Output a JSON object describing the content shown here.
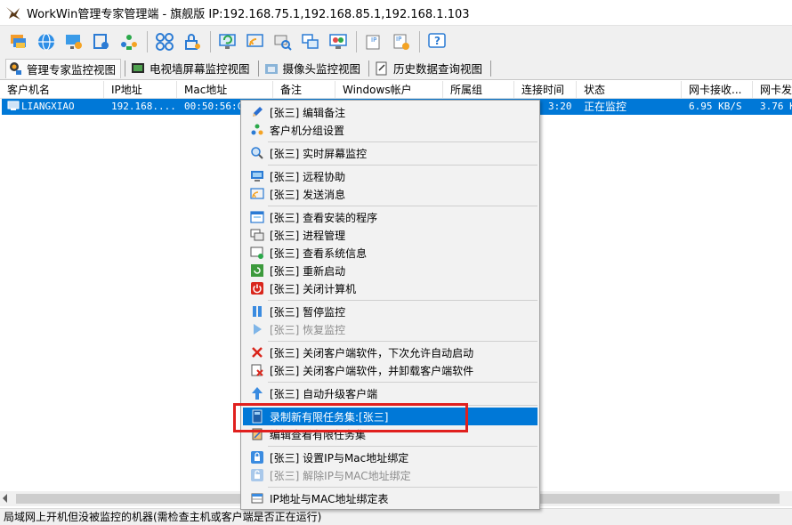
{
  "window": {
    "title": "WorkWin管理专家管理端 - 旗舰版 IP:192.168.75.1,192.168.85.1,192.168.1.103"
  },
  "toolbar": {
    "buttons": [
      {
        "icon": "layers-icon"
      },
      {
        "icon": "globe-icon"
      },
      {
        "icon": "monitor-network-icon"
      },
      {
        "icon": "remote-icon"
      },
      {
        "icon": "users-icon"
      },
      {
        "icon": "grid-icon"
      },
      {
        "icon": "lock-icon"
      },
      {
        "icon": "monitor-refresh-icon"
      },
      {
        "icon": "message-icon"
      },
      {
        "icon": "search-monitor-icon"
      },
      {
        "icon": "windows-icon"
      },
      {
        "icon": "monitor-chart-icon"
      },
      {
        "icon": "ip-tag-icon"
      },
      {
        "icon": "ip-lock-icon"
      },
      {
        "icon": "help-icon"
      }
    ]
  },
  "view_tabs": [
    {
      "label": "管理专家监控视图",
      "icon": "user-monitor-icon",
      "active": true
    },
    {
      "label": "电视墙屏幕监控视图",
      "icon": "tv-wall-icon",
      "active": false
    },
    {
      "label": "摄像头监控视图",
      "icon": "camera-icon",
      "active": false
    },
    {
      "label": "历史数据查询视图",
      "icon": "history-icon",
      "active": false
    }
  ],
  "table": {
    "columns": [
      "客户机名",
      "IP地址",
      "Mac地址",
      "备注",
      "Windows帐户",
      "所属组",
      "连接时间",
      "状态",
      "网卡接收...",
      "网卡发"
    ],
    "rows": [
      {
        "cells": [
          "LIANGXIAO",
          "192.168....",
          "00:50:56:C0",
          "",
          "",
          "",
          "3:20",
          "正在监控",
          "6.95 KB/S",
          "3.76 K"
        ],
        "selected": true
      }
    ]
  },
  "context_menu": {
    "items": [
      {
        "label": "[张三] 编辑备注",
        "icon": "pencil-icon",
        "disabled": false
      },
      {
        "label": "客户机分组设置",
        "icon": "group-icon",
        "disabled": false
      },
      {
        "label": "[张三] 实时屏幕监控",
        "icon": "magnifier-icon",
        "disabled": false
      },
      {
        "label": "[张三] 远程协助",
        "icon": "remote-assist-icon",
        "disabled": false
      },
      {
        "label": "[张三] 发送消息",
        "icon": "send-message-icon",
        "disabled": false
      },
      {
        "label": "[张三] 查看安装的程序",
        "icon": "programs-icon",
        "disabled": false
      },
      {
        "label": "[张三] 进程管理",
        "icon": "process-icon",
        "disabled": false
      },
      {
        "label": "[张三] 查看系统信息",
        "icon": "system-info-icon",
        "disabled": false
      },
      {
        "label": "[张三] 重新启动",
        "icon": "restart-icon",
        "disabled": false
      },
      {
        "label": "[张三] 关闭计算机",
        "icon": "power-icon",
        "disabled": false
      },
      {
        "label": "[张三] 暂停监控",
        "icon": "pause-icon",
        "disabled": false
      },
      {
        "label": "[张三] 恢复监控",
        "icon": "play-icon",
        "disabled": true
      },
      {
        "label": "[张三] 关闭客户端软件，下次允许自动启动",
        "icon": "close-x-icon",
        "disabled": false
      },
      {
        "label": "[张三] 关闭客户端软件，并卸载客户端软件",
        "icon": "uninstall-icon",
        "disabled": false
      },
      {
        "label": "[张三] 自动升级客户端",
        "icon": "upgrade-icon",
        "disabled": false
      },
      {
        "label": "录制新有限任务集:[张三]",
        "icon": "record-task-icon",
        "disabled": false,
        "highlighted": true
      },
      {
        "label": "编辑查看有限任务集",
        "icon": "edit-task-icon",
        "disabled": false
      },
      {
        "label": "[张三] 设置IP与Mac地址绑定",
        "icon": "ip-mac-lock-icon",
        "disabled": false
      },
      {
        "label": "[张三] 解除IP与MAC地址绑定",
        "icon": "ip-mac-unlock-icon",
        "disabled": true
      },
      {
        "label": "IP地址与MAC地址绑定表",
        "icon": "bind-table-icon",
        "disabled": false
      }
    ]
  },
  "status_bar": {
    "text": "局域网上开机但没被监控的机器(需检查主机或客户端是否正在运行)"
  },
  "colors": {
    "selection": "#0078d7",
    "annotation_box": "#e0201e"
  }
}
